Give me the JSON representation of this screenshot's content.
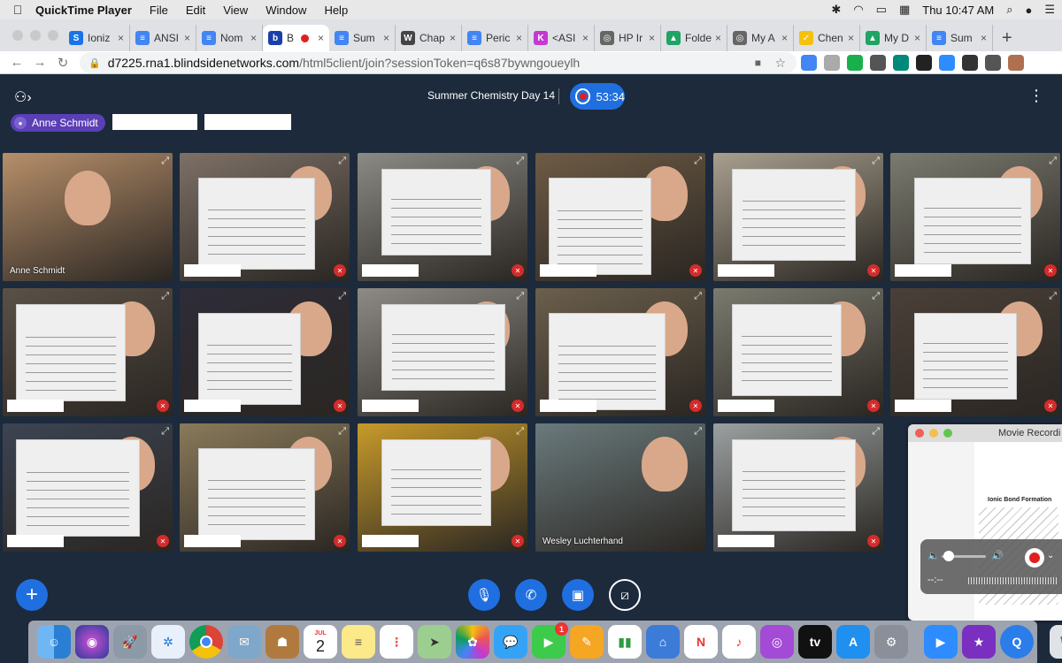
{
  "menubar": {
    "app_name": "QuickTime Player",
    "menus": [
      "File",
      "Edit",
      "View",
      "Window",
      "Help"
    ],
    "clock": "Thu 10:47 AM"
  },
  "browser": {
    "tabs": [
      {
        "label": "Ioniz",
        "icon_color": "#1a73e8",
        "icon_letter": "S"
      },
      {
        "label": "ANSI",
        "icon_color": "#4285f4",
        "icon_letter": "≡"
      },
      {
        "label": "Nom",
        "icon_color": "#4285f4",
        "icon_letter": "≡"
      },
      {
        "label": "B",
        "icon_color": "#1a3fa8",
        "icon_letter": "b"
      },
      {
        "label": "Sum",
        "icon_color": "#4285f4",
        "icon_letter": "≡"
      },
      {
        "label": "Chap",
        "icon_color": "#444444",
        "icon_letter": "W"
      },
      {
        "label": "Peric",
        "icon_color": "#4285f4",
        "icon_letter": "≡"
      },
      {
        "label": "<ASI",
        "icon_color": "#c23ad0",
        "icon_letter": "K"
      },
      {
        "label": "HP Ir",
        "icon_color": "#666666",
        "icon_letter": "◎"
      },
      {
        "label": "Folde",
        "icon_color": "#1fa463",
        "icon_letter": "▲"
      },
      {
        "label": "My A",
        "icon_color": "#666666",
        "icon_letter": "◎"
      },
      {
        "label": "Chen",
        "icon_color": "#f4c20d",
        "icon_letter": "✓"
      },
      {
        "label": "My D",
        "icon_color": "#1fa463",
        "icon_letter": "▲"
      },
      {
        "label": "Sum",
        "icon_color": "#4285f4",
        "icon_letter": "≡"
      }
    ],
    "url_host": "d7225.rna1.blindsidenetworks.com",
    "url_path": "/html5client/join?sessionToken=q6s87bywngoueylh",
    "extension_colors": [
      "#4285f4",
      "#aaaaaa",
      "#19b04b",
      "#555555",
      "#00897b",
      "#222222",
      "#2d8cff",
      "#333333",
      "#555555",
      "#b07050"
    ]
  },
  "meeting": {
    "title": "Summer Chemistry Day 14",
    "recording_time": "53:34",
    "talker": "Anne Schmidt",
    "presenter_name": "Anne Schmidt",
    "participant_name": "Wesley Luchterhand"
  },
  "movie_window": {
    "title": "Movie Recordi",
    "doc_title": "Ionic Bond Formation",
    "time": "--:--"
  },
  "dock": {
    "calendar_month": "JUL",
    "calendar_day": "2",
    "facetime_badge": "1"
  }
}
